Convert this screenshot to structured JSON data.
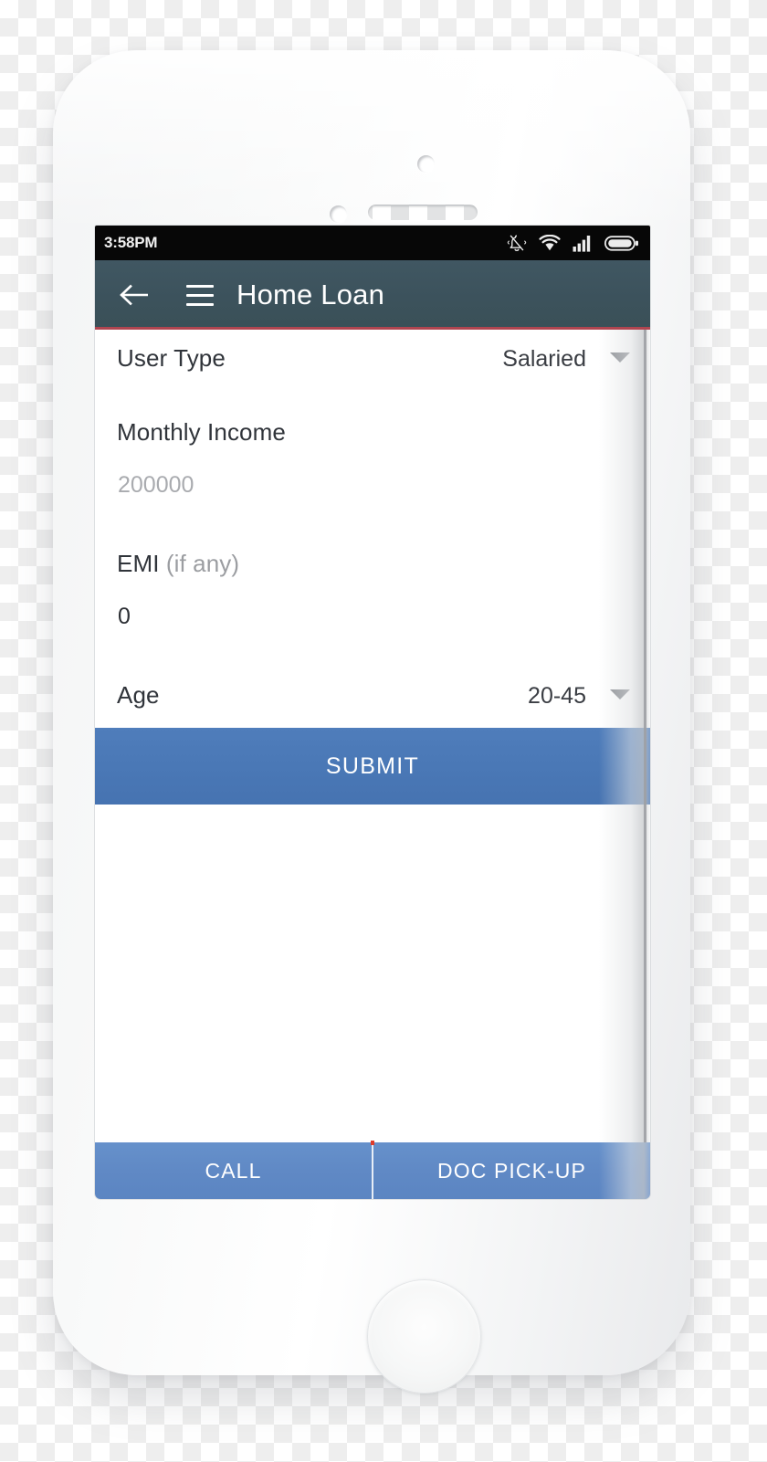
{
  "status_bar": {
    "time": "3:58PM",
    "icons": [
      "notifications-off-icon",
      "wifi-icon",
      "signal-icon",
      "battery-icon"
    ]
  },
  "app_bar": {
    "back_icon": "back-arrow-icon",
    "menu_icon": "hamburger-menu-icon",
    "title": "Home Loan",
    "background_color": "#3c525c",
    "underline_color": "#b04550"
  },
  "form": {
    "fields": [
      {
        "label": "User Type",
        "type": "dropdown",
        "value": "Salaried"
      },
      {
        "label": "Monthly Income",
        "type": "text",
        "value": "200000",
        "value_state": "placeholder"
      },
      {
        "label": "EMI",
        "label_suffix": "(if any)",
        "type": "text",
        "value": "0",
        "value_state": "filled"
      },
      {
        "label": "Age",
        "type": "dropdown",
        "value": "20-45"
      }
    ]
  },
  "submit": {
    "label": "SUBMIT",
    "color": "#4a78b6"
  },
  "bottom_bar": {
    "call_label": "CALL",
    "doc_pickup_label": "DOC PICK-UP",
    "color": "#6089c5",
    "tick_color": "#e03b2a"
  }
}
